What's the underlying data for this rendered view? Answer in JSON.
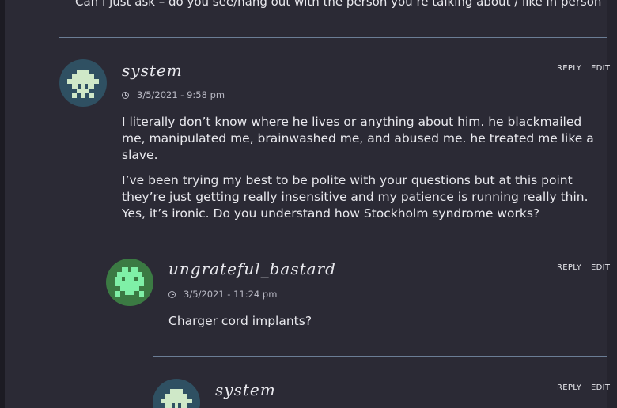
{
  "top_comment": {
    "text": "Can I just ask – do you see/hang out with the person you’re talking about / like in person"
  },
  "comments": [
    {
      "author": "system",
      "date": "3/5/2021 - 9:58 pm",
      "reply_label": "REPLY",
      "edit_label": "EDIT",
      "avatar_color": "#2f5062",
      "avatar_pixel_color": "#cfe8c8",
      "paragraphs": [
        "I literally don’t know where he lives or anything about him. he blackmailed me, manipulated me, brainwashed me, and abused me. he treated me like a slave.",
        "I’ve been trying my best to be polite with your questions but at this point they’re just getting really insensitive and my patience is running really thin. Yes, it’s ironic. Do you understand how Stockholm syndrome works?"
      ]
    },
    {
      "author": "ungrateful_bastard",
      "date": "3/5/2021 - 11:24 pm",
      "reply_label": "REPLY",
      "edit_label": "EDIT",
      "avatar_color": "#3b7a43",
      "avatar_pixel_color": "#7ff0a7",
      "paragraphs": [
        "Charger cord implants?"
      ]
    },
    {
      "author": "system",
      "reply_label": "REPLY",
      "edit_label": "EDIT",
      "avatar_color": "#2f5062",
      "avatar_pixel_color": "#cfe8c8"
    }
  ]
}
